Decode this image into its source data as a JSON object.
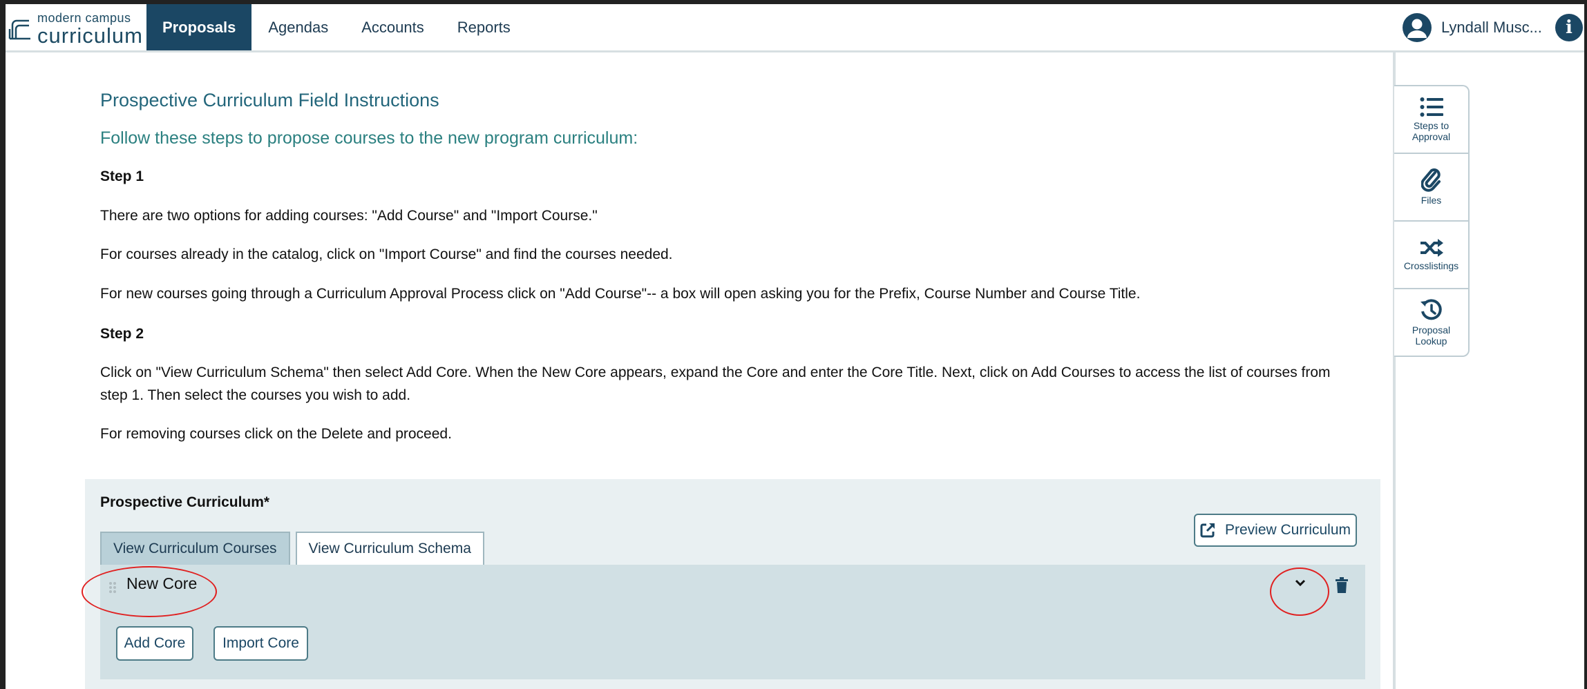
{
  "app": {
    "logo_top": "modern campus",
    "logo_bottom": "curriculum"
  },
  "nav": {
    "items": [
      "Proposals",
      "Agendas",
      "Accounts",
      "Reports"
    ],
    "active": "Proposals"
  },
  "user": {
    "name": "Lyndall Musc..."
  },
  "rail": {
    "items": [
      {
        "label": "Steps to Approval",
        "icon": "list-icon"
      },
      {
        "label": "Files",
        "icon": "paperclip-icon"
      },
      {
        "label": "Crosslistings",
        "icon": "shuffle-icon"
      },
      {
        "label": "Proposal Lookup",
        "icon": "history-icon"
      }
    ]
  },
  "instructions": {
    "title": "Prospective Curriculum Field Instructions",
    "subtitle": "Follow these steps to propose courses to the new program curriculum:",
    "step1": "Step 1",
    "p1": "There are two options for adding courses: \"Add Course\" and \"Import Course.\"",
    "p2": "For courses already in the catalog, click on \"Import Course\" and find the courses needed.",
    "p3": "For new courses going through a Curriculum Approval Process click on \"Add Course\"-- a box will open asking you for the Prefix, Course Number and Course Title.",
    "step2": "Step 2",
    "p4": "Click on \"View Curriculum Schema\" then select Add Core. When the New Core appears, expand the Core and enter the Core Title. Next, click on Add Courses to access the list of courses from step 1. Then select the courses you wish to add.",
    "p5": "For removing courses click on the Delete and proceed."
  },
  "curriculum": {
    "label": "Prospective Curriculum*",
    "tabs": [
      "View Curriculum Courses",
      "View Curriculum Schema"
    ],
    "active_tab": "View Curriculum Courses",
    "preview_label": "Preview Curriculum",
    "core_title": "New Core",
    "add_core_label": "Add Core",
    "import_core_label": "Import Core"
  },
  "colors": {
    "brand": "#1b4764",
    "heading": "#23667b",
    "annotation": "#e02020"
  }
}
